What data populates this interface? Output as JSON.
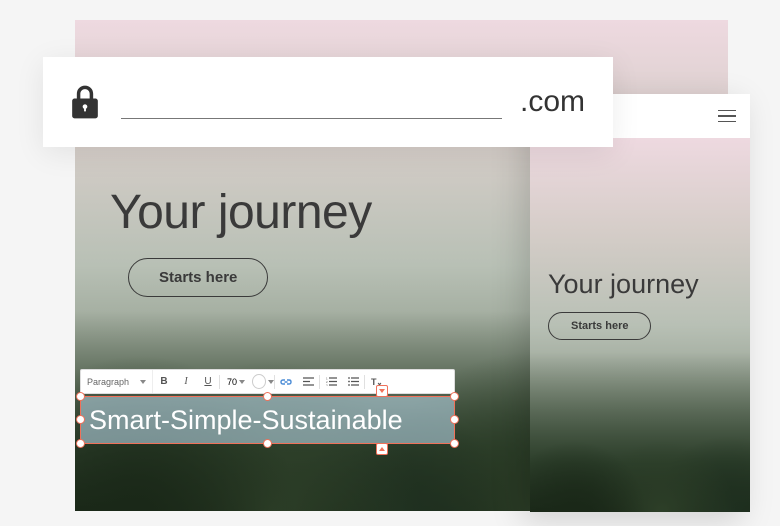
{
  "address": {
    "tld": ".com",
    "url_value": ""
  },
  "hero": {
    "title": "Your journey",
    "button": "Starts here"
  },
  "mobile": {
    "title": "Your journey",
    "button": "Starts here"
  },
  "editor": {
    "format": "Paragraph",
    "font_size": "70",
    "text": "Smart-Simple-Sustainable"
  },
  "toolbar": {
    "bold": "B",
    "italic": "I",
    "underline": "U"
  }
}
